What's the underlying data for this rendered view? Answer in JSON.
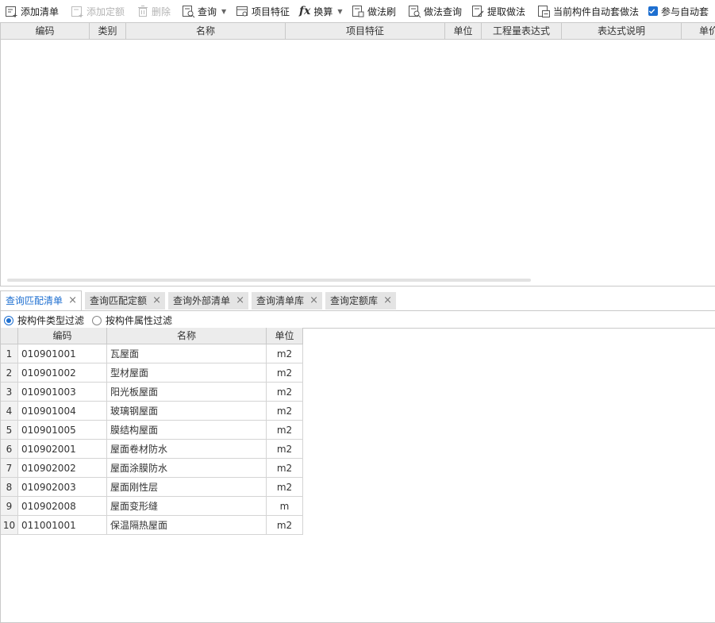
{
  "toolbar": {
    "add_list": "添加清单",
    "add_quota": "添加定额",
    "delete": "删除",
    "query": "查询",
    "item_feature": "项目特征",
    "convert": "换算",
    "method_brush": "做法刷",
    "method_query": "做法查询",
    "extract_method": "提取做法",
    "auto_apply": "当前构件自动套做法",
    "auto_participate": "参与自动套",
    "auto_participate_checked": true
  },
  "upper_table": {
    "columns": [
      "编码",
      "类别",
      "名称",
      "项目特征",
      "单位",
      "工程量表达式",
      "表达式说明",
      "单价"
    ]
  },
  "tabs": [
    {
      "label": "查询匹配清单",
      "active": true
    },
    {
      "label": "查询匹配定额",
      "active": false
    },
    {
      "label": "查询外部清单",
      "active": false
    },
    {
      "label": "查询清单库",
      "active": false
    },
    {
      "label": "查询定额库",
      "active": false
    }
  ],
  "tab_close": "×",
  "filter": {
    "by_type": "按构件类型过滤",
    "by_attr": "按构件属性过滤",
    "selected": "by_type"
  },
  "lower_table": {
    "columns": [
      "",
      "编码",
      "名称",
      "单位"
    ],
    "rows": [
      {
        "n": "1",
        "code": "010901001",
        "name": "瓦屋面",
        "unit": "m2"
      },
      {
        "n": "2",
        "code": "010901002",
        "name": "型材屋面",
        "unit": "m2"
      },
      {
        "n": "3",
        "code": "010901003",
        "name": "阳光板屋面",
        "unit": "m2"
      },
      {
        "n": "4",
        "code": "010901004",
        "name": "玻璃钢屋面",
        "unit": "m2"
      },
      {
        "n": "5",
        "code": "010901005",
        "name": "膜结构屋面",
        "unit": "m2"
      },
      {
        "n": "6",
        "code": "010902001",
        "name": "屋面卷材防水",
        "unit": "m2"
      },
      {
        "n": "7",
        "code": "010902002",
        "name": "屋面涂膜防水",
        "unit": "m2"
      },
      {
        "n": "8",
        "code": "010902003",
        "name": "屋面刚性层",
        "unit": "m2"
      },
      {
        "n": "9",
        "code": "010902008",
        "name": "屋面变形缝",
        "unit": "m"
      },
      {
        "n": "10",
        "code": "011001001",
        "name": "保温隔热屋面",
        "unit": "m2"
      }
    ]
  },
  "colors": {
    "accent": "#1e6fd0",
    "header_bg": "#ececec",
    "border": "#c9c9c9"
  }
}
